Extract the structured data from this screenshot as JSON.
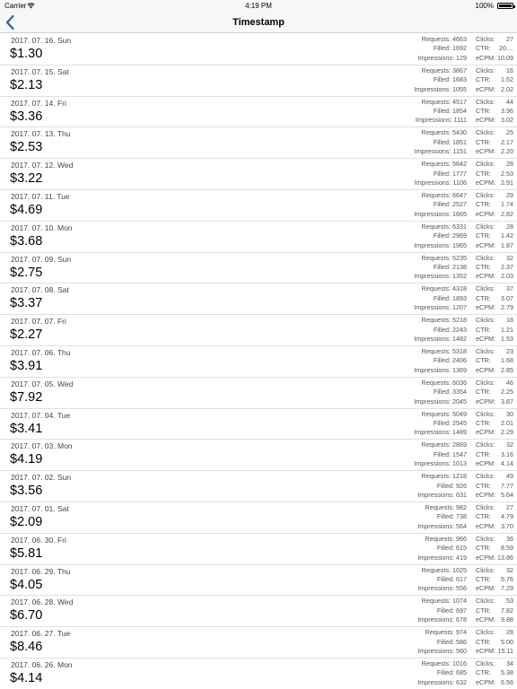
{
  "status_bar": {
    "carrier": "Carrier",
    "time": "4:19 PM",
    "battery": "100%"
  },
  "nav": {
    "title": "Timestamp"
  },
  "labels": {
    "requests": "Requests:",
    "filled": "Filled:",
    "impressions": "Impressions:",
    "clicks": "Clicks:",
    "ctr": "CTR:",
    "ecpm": "eCPM:"
  },
  "rows": [
    {
      "date": "2017. 07. 16. Sun",
      "amount": "$1.30",
      "requests": "4663",
      "filled": "1692",
      "impressions": "129",
      "clicks": "27",
      "ctr": "20....",
      "ecpm": "10.09"
    },
    {
      "date": "2017. 07. 15. Sat",
      "amount": "$2.13",
      "requests": "3867",
      "filled": "1683",
      "impressions": "1055",
      "clicks": "16",
      "ctr": "1.52",
      "ecpm": "2.02"
    },
    {
      "date": "2017. 07. 14. Fri",
      "amount": "$3.36",
      "requests": "4517",
      "filled": "1854",
      "impressions": "1111",
      "clicks": "44",
      "ctr": "3.96",
      "ecpm": "3.02"
    },
    {
      "date": "2017. 07. 13. Thu",
      "amount": "$2.53",
      "requests": "5430",
      "filled": "1851",
      "impressions": "1151",
      "clicks": "25",
      "ctr": "2.17",
      "ecpm": "2.20"
    },
    {
      "date": "2017. 07. 12. Wed",
      "amount": "$3.22",
      "requests": "5842",
      "filled": "1777",
      "impressions": "1106",
      "clicks": "28",
      "ctr": "2.53",
      "ecpm": "2.91"
    },
    {
      "date": "2017. 07. 11. Tue",
      "amount": "$4.69",
      "requests": "6647",
      "filled": "2527",
      "impressions": "1665",
      "clicks": "29",
      "ctr": "1.74",
      "ecpm": "2.82"
    },
    {
      "date": "2017. 07. 10. Mon",
      "amount": "$3.68",
      "requests": "6331",
      "filled": "2969",
      "impressions": "1965",
      "clicks": "28",
      "ctr": "1.42",
      "ecpm": "1.87"
    },
    {
      "date": "2017. 07. 09. Sun",
      "amount": "$2.75",
      "requests": "5235",
      "filled": "2138",
      "impressions": "1352",
      "clicks": "32",
      "ctr": "2.37",
      "ecpm": "2.03"
    },
    {
      "date": "2017. 07. 08. Sat",
      "amount": "$3.37",
      "requests": "4318",
      "filled": "1893",
      "impressions": "1207",
      "clicks": "37",
      "ctr": "3.07",
      "ecpm": "2.79"
    },
    {
      "date": "2017. 07. 07. Fri",
      "amount": "$2.27",
      "requests": "5218",
      "filled": "2243",
      "impressions": "1482",
      "clicks": "18",
      "ctr": "1.21",
      "ecpm": "1.53"
    },
    {
      "date": "2017. 07. 06. Thu",
      "amount": "$3.91",
      "requests": "5318",
      "filled": "2406",
      "impressions": "1369",
      "clicks": "23",
      "ctr": "1.68",
      "ecpm": "2.85"
    },
    {
      "date": "2017. 07. 05. Wed",
      "amount": "$7.92",
      "requests": "6036",
      "filled": "3354",
      "impressions": "2045",
      "clicks": "46",
      "ctr": "2.25",
      "ecpm": "3.87"
    },
    {
      "date": "2017. 07. 04. Tue",
      "amount": "$3.41",
      "requests": "5049",
      "filled": "2545",
      "impressions": "1489",
      "clicks": "30",
      "ctr": "2.01",
      "ecpm": "2.29"
    },
    {
      "date": "2017. 07. 03. Mon",
      "amount": "$4.19",
      "requests": "2869",
      "filled": "1547",
      "impressions": "1013",
      "clicks": "32",
      "ctr": "3.16",
      "ecpm": "4.14"
    },
    {
      "date": "2017. 07. 02. Sun",
      "amount": "$3.56",
      "requests": "1218",
      "filled": "926",
      "impressions": "631",
      "clicks": "49",
      "ctr": "7.77",
      "ecpm": "5.64"
    },
    {
      "date": "2017. 07. 01. Sat",
      "amount": "$2.09",
      "requests": "982",
      "filled": "738",
      "impressions": "564",
      "clicks": "27",
      "ctr": "4.79",
      "ecpm": "3.70"
    },
    {
      "date": "2017. 06. 30. Fri",
      "amount": "$5.81",
      "requests": "966",
      "filled": "615",
      "impressions": "419",
      "clicks": "36",
      "ctr": "8.59",
      "ecpm": "13.86"
    },
    {
      "date": "2017. 06. 29. Thu",
      "amount": "$4.05",
      "requests": "1025",
      "filled": "617",
      "impressions": "556",
      "clicks": "32",
      "ctr": "5.76",
      "ecpm": "7.29"
    },
    {
      "date": "2017. 06. 28. Wed",
      "amount": "$6.70",
      "requests": "1074",
      "filled": "697",
      "impressions": "678",
      "clicks": "53",
      "ctr": "7.82",
      "ecpm": "9.88"
    },
    {
      "date": "2017. 06. 27. Tue",
      "amount": "$8.46",
      "requests": "974",
      "filled": "586",
      "impressions": "560",
      "clicks": "28",
      "ctr": "5.00",
      "ecpm": "15.11"
    },
    {
      "date": "2017. 06. 26. Mon",
      "amount": "$4.14",
      "requests": "1016",
      "filled": "685",
      "impressions": "632",
      "clicks": "34",
      "ctr": "5.38",
      "ecpm": "6.56"
    }
  ]
}
